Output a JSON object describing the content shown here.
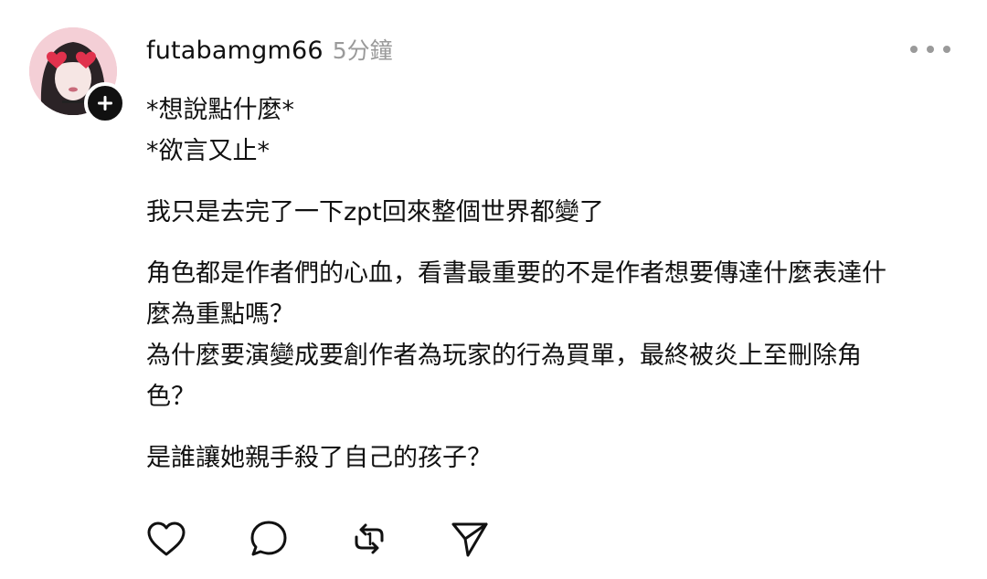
{
  "post": {
    "username": "futabamgm66",
    "timestamp": "5分鐘",
    "paragraphs": [
      "*想說點什麼*\n*欲言又止*",
      "我只是去完了一下zpt回來整個世界都變了",
      "角色都是作者們的心血，看書最重要的不是作者想要傳達什麼表達什\n麼為重點嗎？\n為什麼要演變成要創作者為玩家的行為買單，最終被炎上至刪除角\n色？",
      "是誰讓她親手殺了自己的孩子？"
    ]
  },
  "icons": {
    "avatar": "user-avatar",
    "follow": "plus-icon",
    "more": "more-horizontal-icon",
    "like": "heart-icon",
    "comment": "comment-bubble-icon",
    "repost": "repost-icon",
    "share": "send-icon"
  },
  "colors": {
    "text": "#111111",
    "muted": "#9a9a9a",
    "badge": "#111111",
    "background": "#ffffff"
  }
}
